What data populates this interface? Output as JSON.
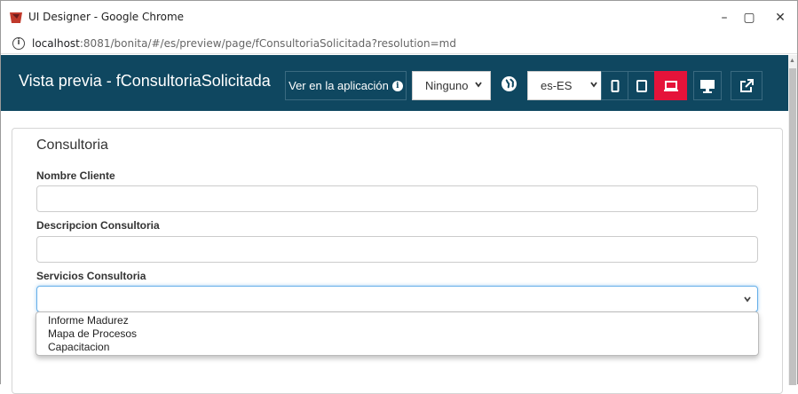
{
  "window": {
    "title": "UI Designer - Google Chrome",
    "minimize_glyph": "–",
    "maximize_glyph": "▢",
    "close_glyph": "✕"
  },
  "address": {
    "info_glyph": "i",
    "host": "localhost",
    "rest": ":8081/bonita/#/es/preview/page/fConsultoriaSolicitada?resolution=md"
  },
  "navbar": {
    "title": "Vista previa - fConsultoriaSolicitada",
    "view_in_app_label": "Ver en la aplicación",
    "app_select_value": "Ninguno",
    "locale_select_value": "es-ES",
    "colors": {
      "background": "#0f4760",
      "active_device": "#e5133a"
    }
  },
  "form": {
    "title": "Consultoria",
    "fields": [
      {
        "label": "Nombre Cliente",
        "value": ""
      },
      {
        "label": "Descripcion Consultoria",
        "value": ""
      },
      {
        "label": "Servicios Consultoria",
        "value": ""
      }
    ],
    "dropdown_options": [
      "Informe Madurez",
      "Mapa de Procesos",
      "Capacitacion"
    ]
  },
  "icons": {
    "app": "ui-designer-logo-icon",
    "info": "info-circle-icon",
    "globe": "globe-icon",
    "devices": [
      "phone-icon",
      "tablet-icon",
      "laptop-icon",
      "desktop-icon",
      "external-link-icon"
    ]
  }
}
